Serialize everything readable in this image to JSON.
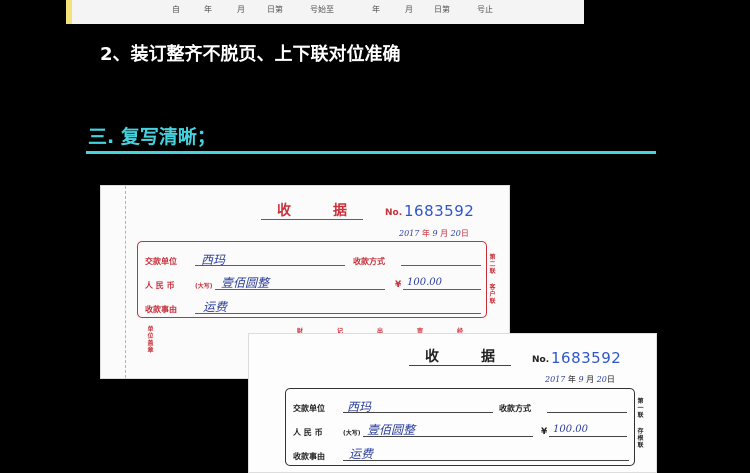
{
  "top_strip": {
    "columns": [
      "自",
      "年",
      "月",
      "日第",
      "号始至",
      "年",
      "月",
      "日第",
      "号止"
    ]
  },
  "point_2": "2、装订整齐不脱页、上下联对位准确",
  "section_3": "三. 复写清晰；",
  "receipts": [
    {
      "title_chars": [
        "收",
        "据"
      ],
      "no_label": "No.",
      "no_value": "1683592",
      "date": {
        "year": "2017",
        "year_unit": "年",
        "month": "9",
        "month_unit": "月",
        "day": "20",
        "day_unit": "日"
      },
      "payer_label": "交款单位",
      "payer_value": "西玛",
      "method_label": "收款方式",
      "amount_label": "人 民 币",
      "amount_hint": "(大写)",
      "amount_words": "壹佰圆整",
      "amount_symbol": "¥",
      "amount_value": "100.00",
      "reason_label": "收款事由",
      "reason_value": "运费",
      "side_copy": "第二联",
      "side_purpose": "客户联",
      "left_vertical": "单位盖章",
      "footer": [
        "财",
        "记",
        "出",
        "审",
        "经"
      ]
    },
    {
      "title_chars": [
        "收",
        "据"
      ],
      "no_label": "No.",
      "no_value": "1683592",
      "date": {
        "year": "2017",
        "year_unit": "年",
        "month": "9",
        "month_unit": "月",
        "day": "20",
        "day_unit": "日"
      },
      "payer_label": "交款单位",
      "payer_value": "西玛",
      "method_label": "收款方式",
      "amount_label": "人 民 币",
      "amount_hint": "(大写)",
      "amount_words": "壹佰圆整",
      "amount_symbol": "¥",
      "amount_value": "100.00",
      "reason_label": "收款事由",
      "reason_value": "运费",
      "side_copy": "第一联",
      "side_purpose": "存根联"
    }
  ],
  "colors": {
    "accent": "#46d3e0",
    "receipt_red": "#c8303a",
    "number_blue": "#2f56c9",
    "ink": "#2a3d9a"
  }
}
